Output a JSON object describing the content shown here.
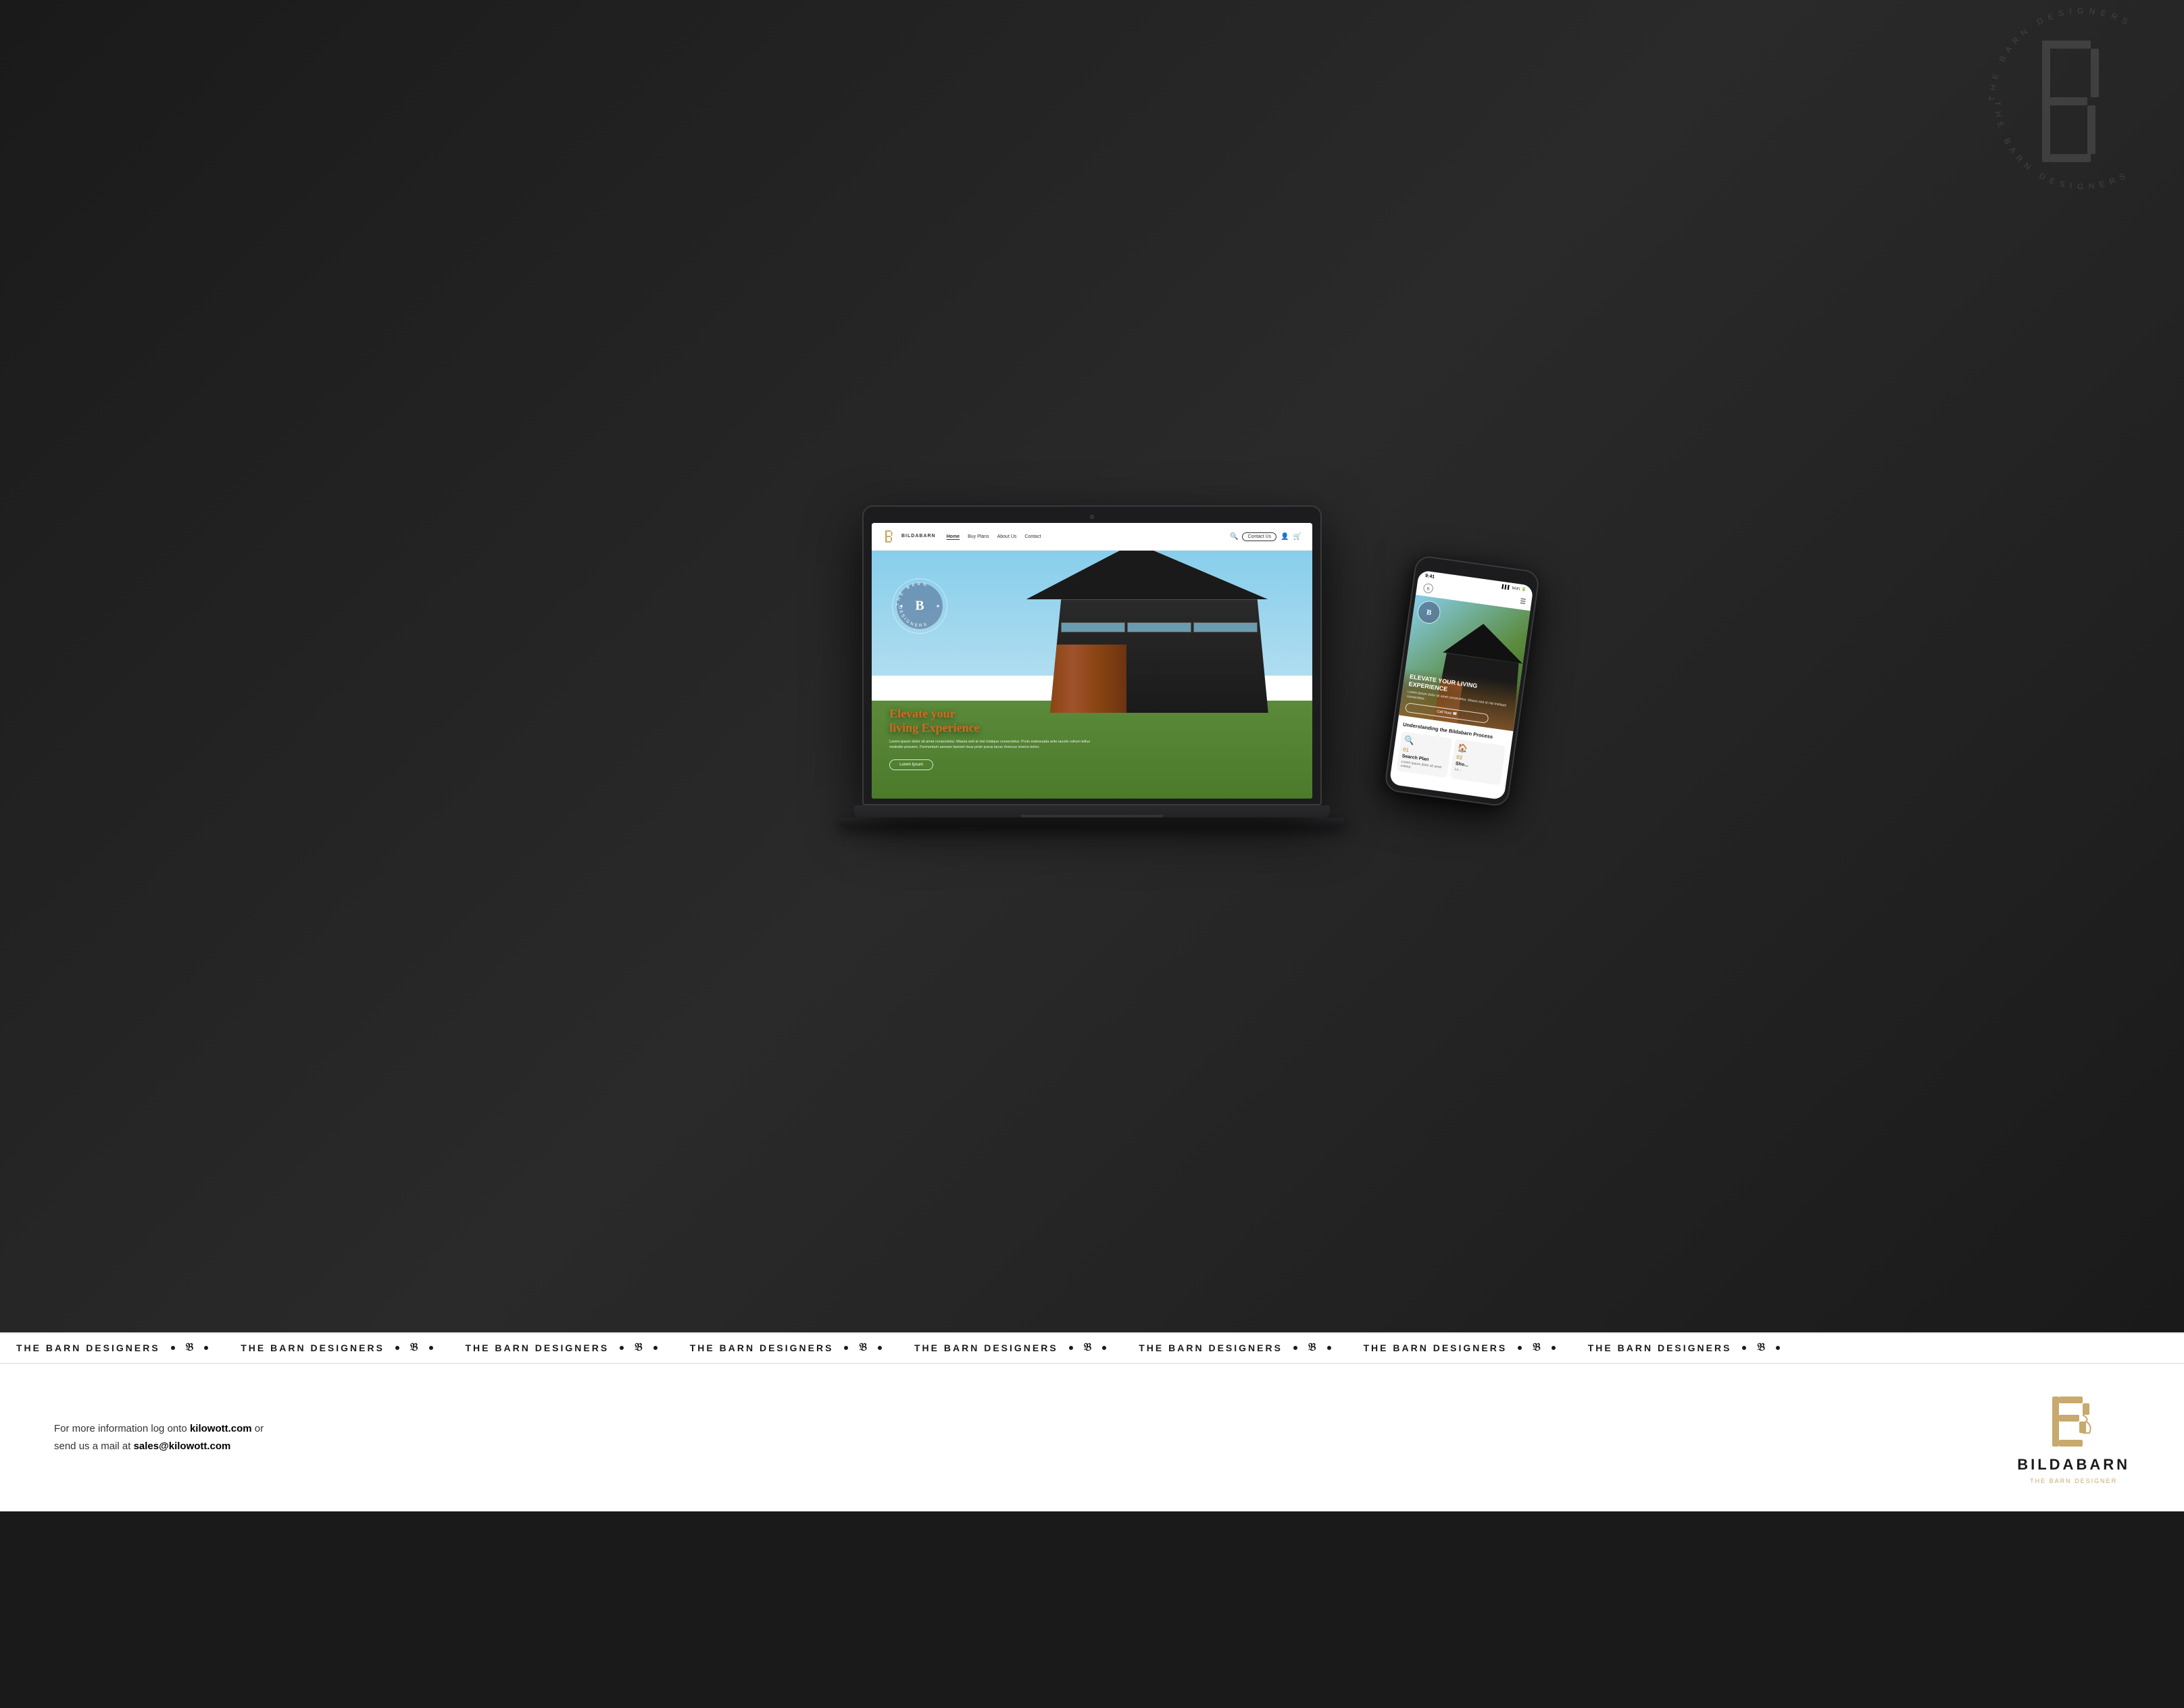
{
  "brand": {
    "name": "BILDABARN",
    "tagline": "THE BARN DESIGNER",
    "logo_letter": "B"
  },
  "nav": {
    "logo_name": "BILDABARN",
    "links": [
      {
        "label": "Home",
        "active": true
      },
      {
        "label": "Buy Plans",
        "active": false
      },
      {
        "label": "About Us",
        "active": false
      },
      {
        "label": "Contact",
        "active": false
      }
    ],
    "contact_btn": "Contact Us",
    "search_placeholder": "Search"
  },
  "hero": {
    "title_line1": "Elevate your",
    "title_line2": "living Experience",
    "title_highlight": "Elevate",
    "description": "Lorem ipsum dolor sit amet consectetur. Massa sed at nisi tristique consectetur. Proin malesuada ante iaculis rutrum tellus molestie posuere. Fermentum aenean laoreet risus proin purus lacus rhoncus viverra tortor.",
    "cta_label": "Lorem Ipsum"
  },
  "phone_hero": {
    "title": "ELEVATE YOUR LIVING EXPERIENCE",
    "description": "Lorem ipsum dolor sit amet consectetur. Massa sed at nisi tristique consectetur.",
    "cta_label": "Call Now ☎"
  },
  "phone_section": {
    "title": "Understanding the Bildabarn Process",
    "cards": [
      {
        "number": "01",
        "title": "Search Plan",
        "description": "Lorem ipsum dolor sit amet cotetur",
        "icon": "🔍"
      },
      {
        "number": "02",
        "title": "Sho...",
        "description": "Lo...",
        "icon": "🏠"
      }
    ]
  },
  "ticker": {
    "items": [
      "THE BARN DESIGNERS",
      "THE BARN DESIGNERS",
      "THE BARN DESIGNERS",
      "THE BARN DESIGNERS",
      "THE BARN DESIGNERS",
      "THE BARN DESIGNERS",
      "THE BARN DESIGNERS",
      "THE BARN DESIGNERS"
    ]
  },
  "footer": {
    "info_text": "For more information log onto ",
    "website": "kilowott.com",
    "middle_text": " or\nsend us a mail at ",
    "email": "sales@kilowott.com"
  },
  "phone_status": {
    "time": "9:41",
    "signal": "▌▌▌",
    "wifi": "WiFi",
    "battery": "🔋"
  }
}
